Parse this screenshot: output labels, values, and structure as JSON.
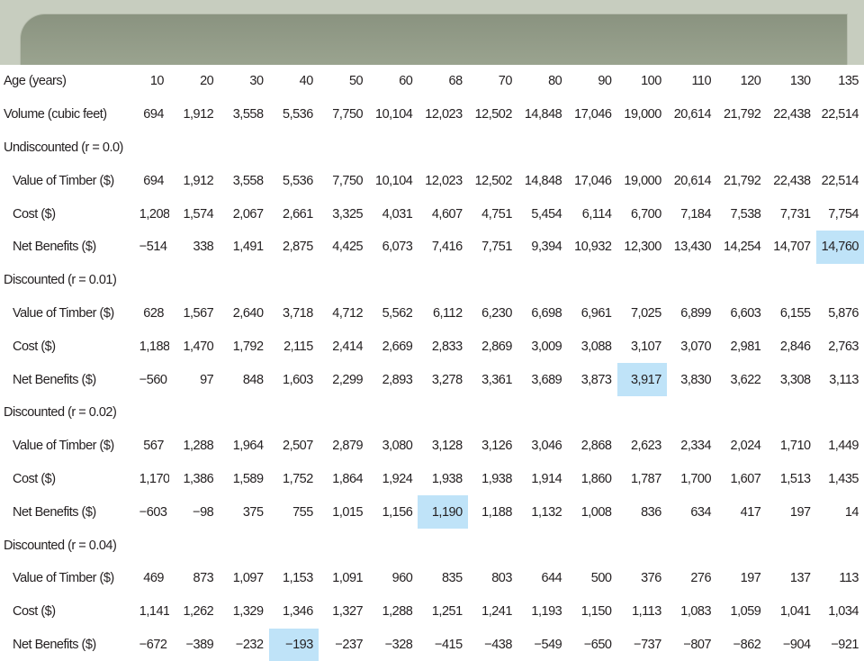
{
  "ages": [
    "10",
    "20",
    "30",
    "40",
    "50",
    "60",
    "68",
    "70",
    "80",
    "90",
    "100",
    "110",
    "120",
    "130",
    "135"
  ],
  "header_label": "Age (years)",
  "rows": [
    {
      "label": "Volume (cubic feet)",
      "indent": false,
      "values": [
        "694",
        "1,912",
        "3,558",
        "5,536",
        "7,750",
        "10,104",
        "12,023",
        "12,502",
        "14,848",
        "17,046",
        "19,000",
        "20,614",
        "21,792",
        "22,438",
        "22,514"
      ]
    },
    {
      "label": "Undiscounted (r = 0.0)",
      "section": true
    },
    {
      "label": "Value of Timber ($)",
      "indent": true,
      "values": [
        "694",
        "1,912",
        "3,558",
        "5,536",
        "7,750",
        "10,104",
        "12,023",
        "12,502",
        "14,848",
        "17,046",
        "19,000",
        "20,614",
        "21,792",
        "22,438",
        "22,514"
      ]
    },
    {
      "label": "Cost ($)",
      "indent": true,
      "values": [
        "1,208",
        "1,574",
        "2,067",
        "2,661",
        "3,325",
        "4,031",
        "4,607",
        "4,751",
        "5,454",
        "6,114",
        "6,700",
        "7,184",
        "7,538",
        "7,731",
        "7,754"
      ]
    },
    {
      "label": "Net Benefits ($)",
      "indent": true,
      "values": [
        "−514",
        "338",
        "1,491",
        "2,875",
        "4,425",
        "6,073",
        "7,416",
        "7,751",
        "9,394",
        "10,932",
        "12,300",
        "13,430",
        "14,254",
        "14,707",
        "14,760"
      ],
      "highlight": 14
    },
    {
      "label": "Discounted (r = 0.01)",
      "section": true
    },
    {
      "label": "Value of Timber ($)",
      "indent": true,
      "values": [
        "628",
        "1,567",
        "2,640",
        "3,718",
        "4,712",
        "5,562",
        "6,112",
        "6,230",
        "6,698",
        "6,961",
        "7,025",
        "6,899",
        "6,603",
        "6,155",
        "5,876"
      ]
    },
    {
      "label": "Cost ($)",
      "indent": true,
      "values": [
        "1,188",
        "1,470",
        "1,792",
        "2,115",
        "2,414",
        "2,669",
        "2,833",
        "2,869",
        "3,009",
        "3,088",
        "3,107",
        "3,070",
        "2,981",
        "2,846",
        "2,763"
      ]
    },
    {
      "label": "Net Benefits ($)",
      "indent": true,
      "values": [
        "−560",
        "97",
        "848",
        "1,603",
        "2,299",
        "2,893",
        "3,278",
        "3,361",
        "3,689",
        "3,873",
        "3,917",
        "3,830",
        "3,622",
        "3,308",
        "3,113"
      ],
      "highlight": 10
    },
    {
      "label": "Discounted (r = 0.02)",
      "section": true
    },
    {
      "label": "Value of Timber ($)",
      "indent": true,
      "values": [
        "567",
        "1,288",
        "1,964",
        "2,507",
        "2,879",
        "3,080",
        "3,128",
        "3,126",
        "3,046",
        "2,868",
        "2,623",
        "2,334",
        "2,024",
        "1,710",
        "1,449"
      ]
    },
    {
      "label": "Cost ($)",
      "indent": true,
      "values": [
        "1,170",
        "1,386",
        "1,589",
        "1,752",
        "1,864",
        "1,924",
        "1,938",
        "1,938",
        "1,914",
        "1,860",
        "1,787",
        "1,700",
        "1,607",
        "1,513",
        "1,435"
      ]
    },
    {
      "label": "Net Benefits ($)",
      "indent": true,
      "values": [
        "−603",
        "−98",
        "375",
        "755",
        "1,015",
        "1,156",
        "1,190",
        "1,188",
        "1,132",
        "1,008",
        "836",
        "634",
        "417",
        "197",
        "14"
      ],
      "highlight": 6
    },
    {
      "label": "Discounted (r = 0.04)",
      "section": true
    },
    {
      "label": "Value of Timber ($)",
      "indent": true,
      "values": [
        "469",
        "873",
        "1,097",
        "1,153",
        "1,091",
        "960",
        "835",
        "803",
        "644",
        "500",
        "376",
        "276",
        "197",
        "137",
        "113"
      ]
    },
    {
      "label": "Cost ($)",
      "indent": true,
      "values": [
        "1,141",
        "1,262",
        "1,329",
        "1,346",
        "1,327",
        "1,288",
        "1,251",
        "1,241",
        "1,193",
        "1,150",
        "1,113",
        "1,083",
        "1,059",
        "1,041",
        "1,034"
      ]
    },
    {
      "label": "Net Benefits ($)",
      "indent": true,
      "values": [
        "−672",
        "−389",
        "−232",
        "−193",
        "−237",
        "−328",
        "−415",
        "−438",
        "−549",
        "−650",
        "−737",
        "−807",
        "−862",
        "−904",
        "−921"
      ],
      "highlight": 3
    }
  ],
  "colors": {
    "highlight": "#bfe3f8",
    "banner": "#9aa38f"
  }
}
